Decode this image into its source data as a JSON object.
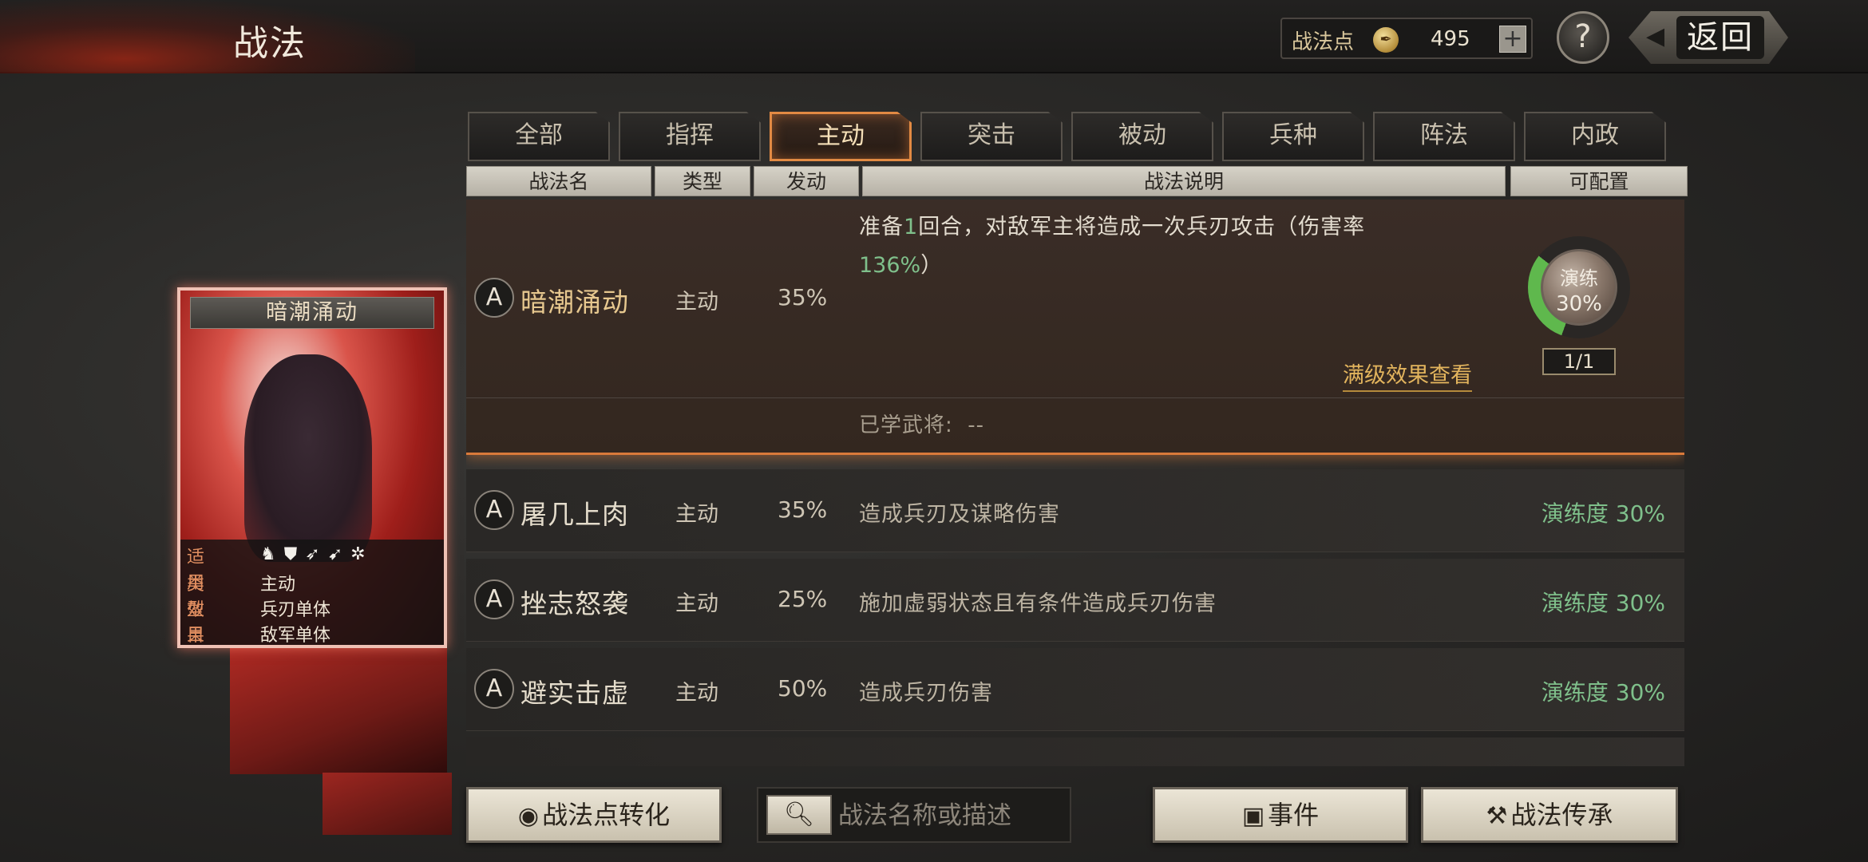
{
  "header": {
    "title": "战法",
    "points_label": "战法点",
    "points_value": "495",
    "plus_icon": "plus-icon",
    "help_label": "?",
    "back_label": "返回"
  },
  "tabs": [
    {
      "label": "全部"
    },
    {
      "label": "指挥"
    },
    {
      "label": "主动",
      "active": true
    },
    {
      "label": "突击"
    },
    {
      "label": "被动"
    },
    {
      "label": "兵种"
    },
    {
      "label": "阵法"
    },
    {
      "label": "内政"
    }
  ],
  "columns": {
    "name": "战法名",
    "type": "类型",
    "rate": "发动",
    "desc": "战法说明",
    "config": "可配置"
  },
  "selected_skill": {
    "grade": "A",
    "name": "暗潮涌动",
    "type": "主动",
    "rate": "35%",
    "desc_prefix": "准备",
    "desc_num": "1",
    "desc_suffix": "回合，对敌军主将造成一次兵刃攻击（伤害率",
    "desc_pct": "136%",
    "desc_close": "）",
    "full_effect_label": "满级效果查看",
    "learned_label": "已学武将:",
    "learned_value": "--",
    "practice_label": "演练",
    "practice_value": "30%",
    "practice_fraction": 0.3,
    "practice_count": "1/1"
  },
  "skills": [
    {
      "grade": "A",
      "name": "屠几上肉",
      "type": "主动",
      "rate": "35%",
      "desc": "造成兵刃及谋略伤害",
      "practice": "演练度 30%"
    },
    {
      "grade": "A",
      "name": "挫志怒袭",
      "type": "主动",
      "rate": "25%",
      "desc": "施加虚弱状态且有条件造成兵刃伤害",
      "practice": "演练度 30%"
    },
    {
      "grade": "A",
      "name": "避实击虚",
      "type": "主动",
      "rate": "50%",
      "desc": "造成兵刃伤害",
      "practice": "演练度 30%"
    }
  ],
  "card": {
    "title": "暗潮涌动",
    "apply_label": "适用",
    "troop_icons": [
      "cavalry-icon",
      "shield-icon",
      "bow-icon",
      "spear-icon",
      "wheel-icon"
    ],
    "type_label": "类型",
    "type_value": "主动",
    "effect_label": "效果",
    "effect_value": "兵刃单体",
    "target_label": "目标",
    "target_value": "敌军单体"
  },
  "bottom": {
    "convert_label": "战法点转化",
    "search_placeholder": "战法名称或描述",
    "event_label": "事件",
    "inherit_label": "战法传承"
  },
  "colors": {
    "accent_orange": "#e28a43",
    "practice_green": "#7fc08b",
    "gold_text": "#e2b45d"
  }
}
